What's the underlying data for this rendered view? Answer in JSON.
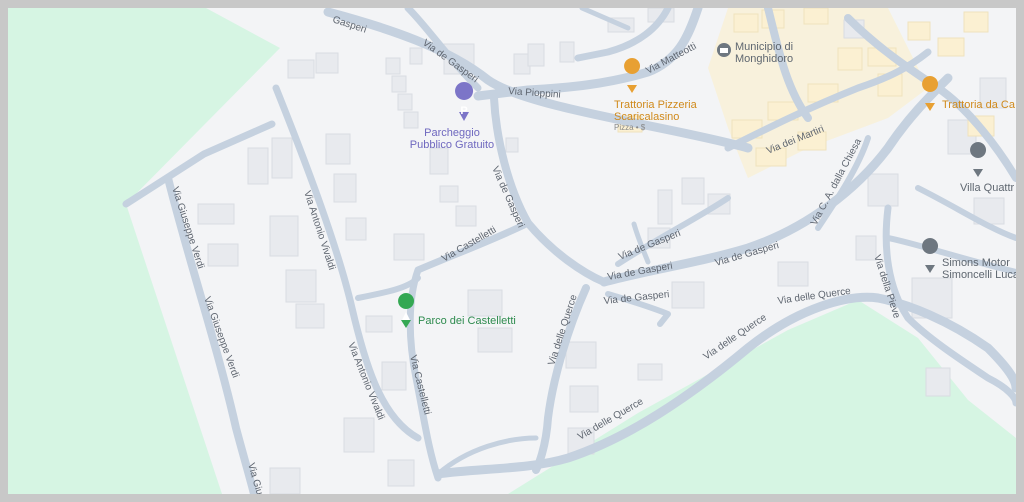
{
  "streets": {
    "gasperi_a": "Via de Gasperi",
    "gasperi_b": "Via de Gasperi",
    "gasperi_c": "Via de Gasperi",
    "gasperi_d": "Via de Gasperi",
    "gasperi_e": "Via de Gasperi",
    "gasperi_f": "Via de Gasperi",
    "gasperi_top": "Gasperi",
    "pioppini": "Via Pioppini",
    "matteotti": "Via Matteotti",
    "martiri": "Via dei Martiri",
    "chiesa": "Via C. A. dalla Chiesa",
    "pieve": "Via della Pieve",
    "quercie_a": "Via delle Querce",
    "quercie_b": "Via delle Querce",
    "quercie_c": "Via delle Querce",
    "quercie_d": "Via delle Querce",
    "castelletti_a": "Via Castelletti",
    "castelletti_b": "Via Castelletti",
    "vivaldi_a": "Via Antonio Vivaldi",
    "vivaldi_b": "Via Antonio Vivaldi",
    "verdi_a": "Via Giuseppe Verdi",
    "verdi_b": "Via Giuseppe Verdi",
    "verdi_c": "Via Giu"
  },
  "pois": {
    "parking": {
      "line1": "Parcheggio",
      "line2": "Pubblico Gratuito",
      "glyph": "P",
      "icon": "parking-icon",
      "color": "#7c75c8"
    },
    "municipio": {
      "line1": "Municipio di",
      "line2": "Monghidoro",
      "icon": "government-building-icon",
      "color": "#5f6770"
    },
    "trattoria1": {
      "line1": "Trattoria Pizzeria",
      "line2": "Scaricalasino",
      "sub": "Pizza • $",
      "icon": "fork-knife-icon",
      "color": "#e8a032"
    },
    "trattoria2": {
      "line1": "Trattoria da Ca",
      "icon": "fork-knife-icon",
      "color": "#e8a032"
    },
    "villa": {
      "line1": "Villa Quattr",
      "icon": "location-pin-icon",
      "color": "#5f6770"
    },
    "simons": {
      "line1": "Simons Motor",
      "line2": "Simoncelli Luca",
      "icon": "location-pin-icon",
      "color": "#5f6770"
    },
    "parco": {
      "line1": "Parco dei Castelletti",
      "icon": "tree-icon",
      "color": "#34a853"
    }
  },
  "colors": {
    "park": "#d6f5e3",
    "road": "#c5d1df",
    "land": "#f3f4f6",
    "building": "#e8eaee",
    "commercial": "#fbf0d2"
  }
}
